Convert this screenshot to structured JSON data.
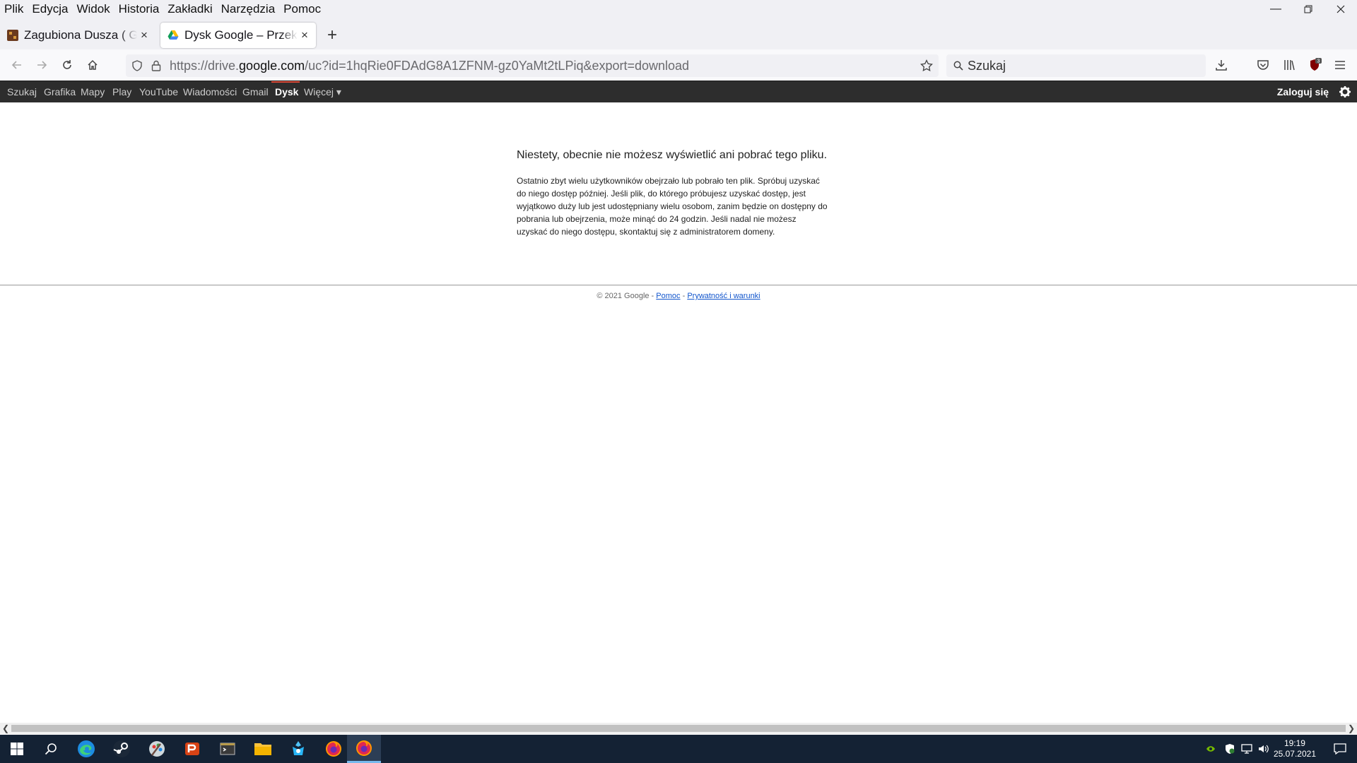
{
  "menu": [
    "Plik",
    "Edycja",
    "Widok",
    "Historia",
    "Zakładki",
    "Narzędzia",
    "Pomoc"
  ],
  "tabs": [
    {
      "title": "Zagubiona Dusza ( Gone",
      "close": "×"
    },
    {
      "title": "Dysk Google – Przekroczono",
      "close": "×"
    }
  ],
  "new_tab": "+",
  "url": {
    "prefix": "https://drive.",
    "domain": "google.com",
    "path": "/uc?id=1hqRie0FDAdG8A1ZFNM-gz0YaMt2tLPiq&export=download"
  },
  "search": {
    "placeholder": "Szukaj"
  },
  "gbar": {
    "items": [
      "Szukaj",
      "Grafika",
      "Mapy",
      "Play",
      "YouTube",
      "Wiadomości",
      "Gmail",
      "Dysk",
      "Więcej ▾"
    ],
    "active": "Dysk",
    "login": "Zaloguj się"
  },
  "message": {
    "heading": "Niestety, obecnie nie możesz wyświetlić ani pobrać tego pliku.",
    "body": "Ostatnio zbyt wielu użytkowników obejrzało lub pobrało ten plik. Spróbuj uzyskać do niego dostęp później. Jeśli plik, do którego próbujesz uzyskać dostęp, jest wyjątkowo duży lub jest udostępniany wielu osobom, zanim będzie on dostępny do pobrania lub obejrzenia, może minąć do 24 godzin. Jeśli nadal nie możesz uzyskać do niego dostępu, skontaktuj się z administratorem domeny."
  },
  "footer": {
    "copyright": "© 2021 Google - ",
    "sep": " - ",
    "help": "Pomoc",
    "privacy": "Prywatność i warunki"
  },
  "ublock_badge": "3",
  "clock": {
    "time": "19:19",
    "date": "25.07.2021"
  },
  "colors": {
    "gbar_bg": "#2d2d2d",
    "active_indicator": "#dd4b39",
    "link": "#1155cc",
    "taskbar": "#142234"
  }
}
